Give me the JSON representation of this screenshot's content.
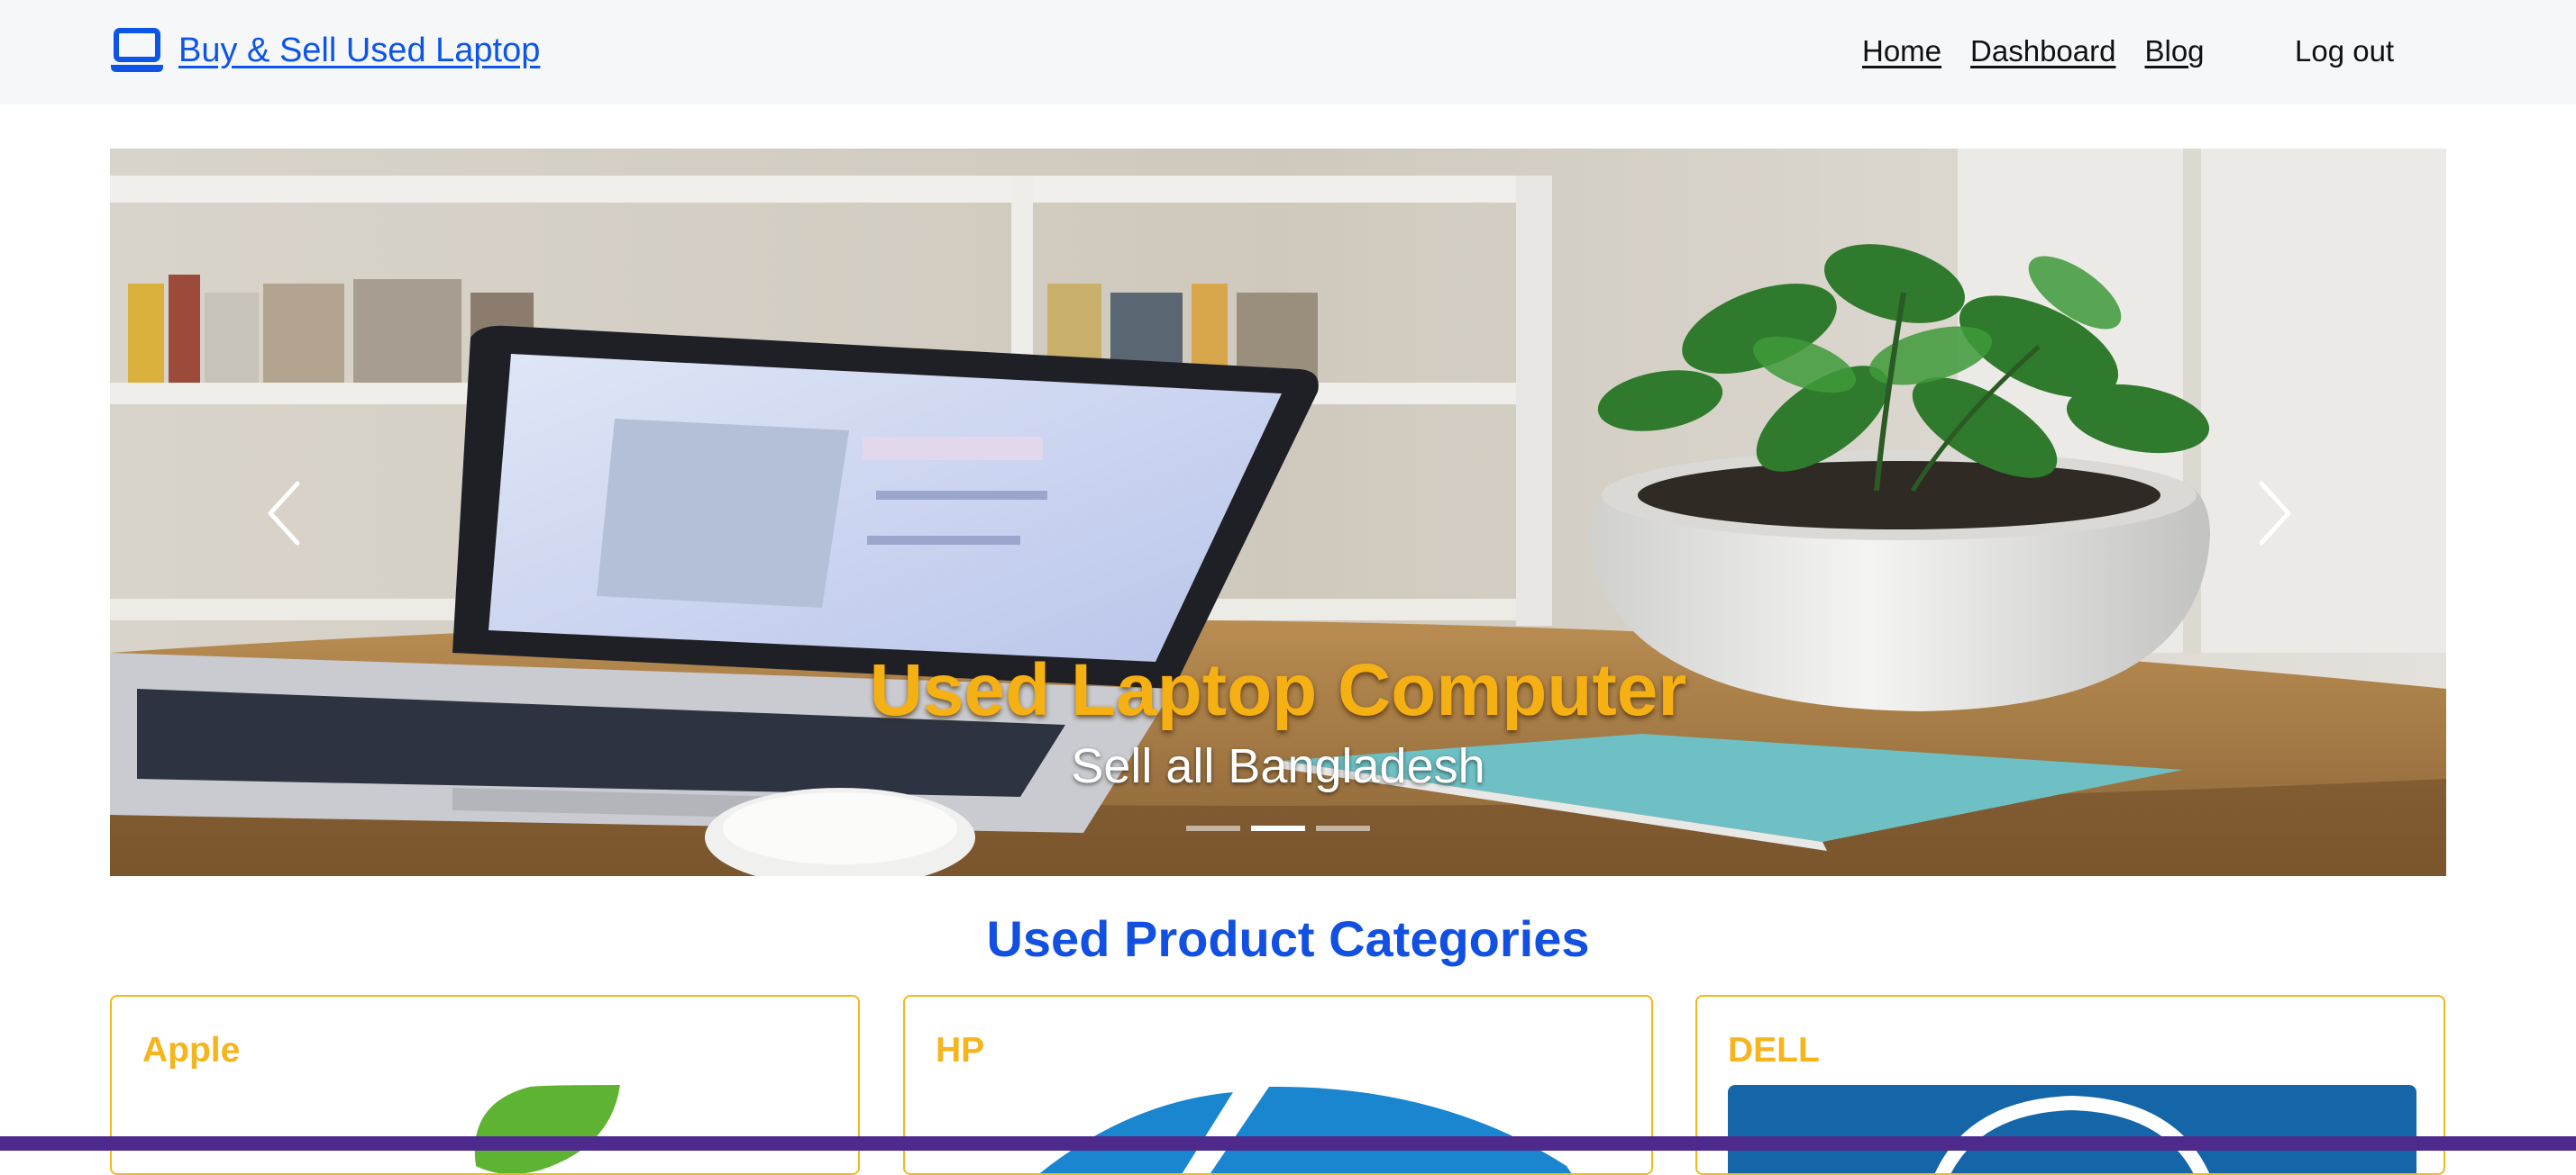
{
  "navbar": {
    "brand_icon": "laptop-icon",
    "brand_label": "Buy & Sell Used Laptop",
    "links": [
      {
        "label": "Home"
      },
      {
        "label": "Dashboard"
      },
      {
        "label": "Blog"
      }
    ],
    "logout_label": "Log out"
  },
  "carousel": {
    "prev_icon": "chevron-left-icon",
    "next_icon": "chevron-right-icon",
    "caption_title": "Used Laptop Computer",
    "caption_subtitle": "Sell all Bangladesh",
    "slide_count": 3,
    "active_slide": 2
  },
  "categories": {
    "title": "Used Product Categories",
    "items": [
      {
        "name": "Apple",
        "logo": "apple-logo"
      },
      {
        "name": "HP",
        "logo": "hp-logo"
      },
      {
        "name": "DELL",
        "logo": "dell-logo"
      }
    ]
  },
  "colors": {
    "brand_blue": "#0d55e6",
    "accent_yellow": "#f5b81c",
    "footer_purple": "#4d2a8c"
  }
}
